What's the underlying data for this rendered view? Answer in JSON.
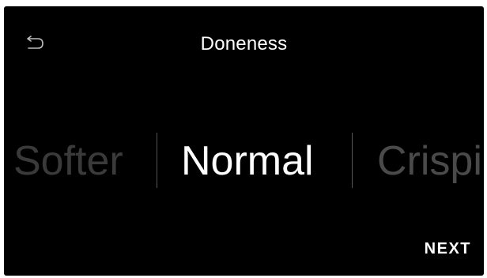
{
  "header": {
    "title": "Doneness",
    "back_icon": "undo-arrow-icon"
  },
  "picker": {
    "options": [
      "Softer",
      "Normal",
      "Crispier"
    ],
    "selected_index": 1,
    "visible": {
      "previous": "Softer",
      "selected": "Normal",
      "next": "Crispi"
    }
  },
  "footer": {
    "next_label": "NEXT"
  },
  "colors": {
    "background": "#000000",
    "text": "#ffffff",
    "dim_text": "#3a3a3a",
    "divider": "#555555"
  }
}
